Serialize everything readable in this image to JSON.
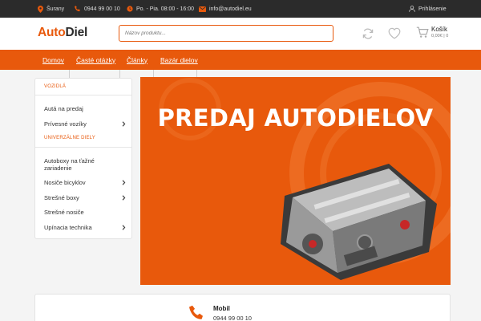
{
  "topbar": {
    "location": "Šurany",
    "phone": "0944 99 00 10",
    "hours": "Po. - Pia. 08:00 - 16:00",
    "email": "info@autodiel.eu",
    "login": "Prihlásenie"
  },
  "header": {
    "logo_part1": "Auto",
    "logo_part2": "Diel",
    "search_placeholder": "Názov produktu...",
    "cart_label": "Košík",
    "cart_sub": "0,00€ | 0"
  },
  "nav": {
    "items": [
      {
        "label": "Domov"
      },
      {
        "label": "Časté otázky"
      },
      {
        "label": "Články"
      },
      {
        "label": "Bazár dielov"
      }
    ]
  },
  "sidebar": {
    "cat1": "VOZIDLÁ",
    "item1": "Autá na predaj",
    "item2": "Prívesné vozíky",
    "cat2": "UNIVERZÁLNE DIELY",
    "item3": "Autoboxy na ťažné zariadenie",
    "item4": "Nosiče bicyklov",
    "item5": "Strešné boxy",
    "item6": "Strešné nosiče",
    "item7": "Upínacia technika"
  },
  "banner": {
    "title": "PREDAJ AUTODIELOV"
  },
  "contact": {
    "title": "Mobil",
    "phone": "0944 99 00 10"
  },
  "colors": {
    "accent": "#e8590c",
    "topbar_bg": "#2b2b2b",
    "page_bg": "#f4f4f4"
  }
}
